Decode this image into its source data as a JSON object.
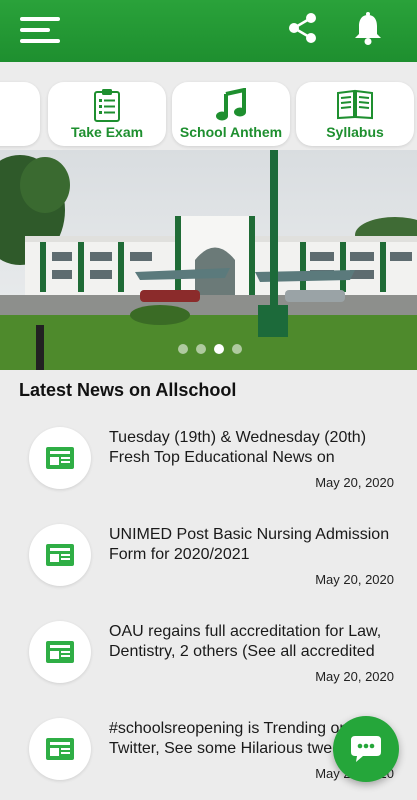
{
  "header": {
    "menu_icon": "menu-icon",
    "share_icon": "share-icon",
    "bell_icon": "bell-icon"
  },
  "shortcuts": [
    {
      "label": "",
      "icon": "unknown-icon"
    },
    {
      "label": "Take Exam",
      "icon": "clipboard-icon"
    },
    {
      "label": "School Anthem",
      "icon": "music-note-icon"
    },
    {
      "label": "Syllabus",
      "icon": "book-icon"
    }
  ],
  "banner": {
    "slides": 4,
    "active_slide": 3
  },
  "news": {
    "title": "Latest News on Allschool",
    "items": [
      {
        "headline": "Tuesday (19th) & Wednesday (20th) Fresh Top Educational News on",
        "date": "May 20, 2020"
      },
      {
        "headline": "UNIMED Post Basic Nursing Admission Form for 2020/2021",
        "date": "May 20, 2020"
      },
      {
        "headline": "OAU regains full accreditation for Law, Dentistry, 2 others (See all accredited",
        "date": "May 20, 2020"
      },
      {
        "headline": "#schoolsreopening is Trending on Twitter, See some Hilarious tweets",
        "date": "May 20, 2020"
      }
    ]
  },
  "fab": {
    "icon": "chat-icon"
  },
  "colors": {
    "brand_green": "#1e8f2f",
    "background": "#ececec"
  }
}
